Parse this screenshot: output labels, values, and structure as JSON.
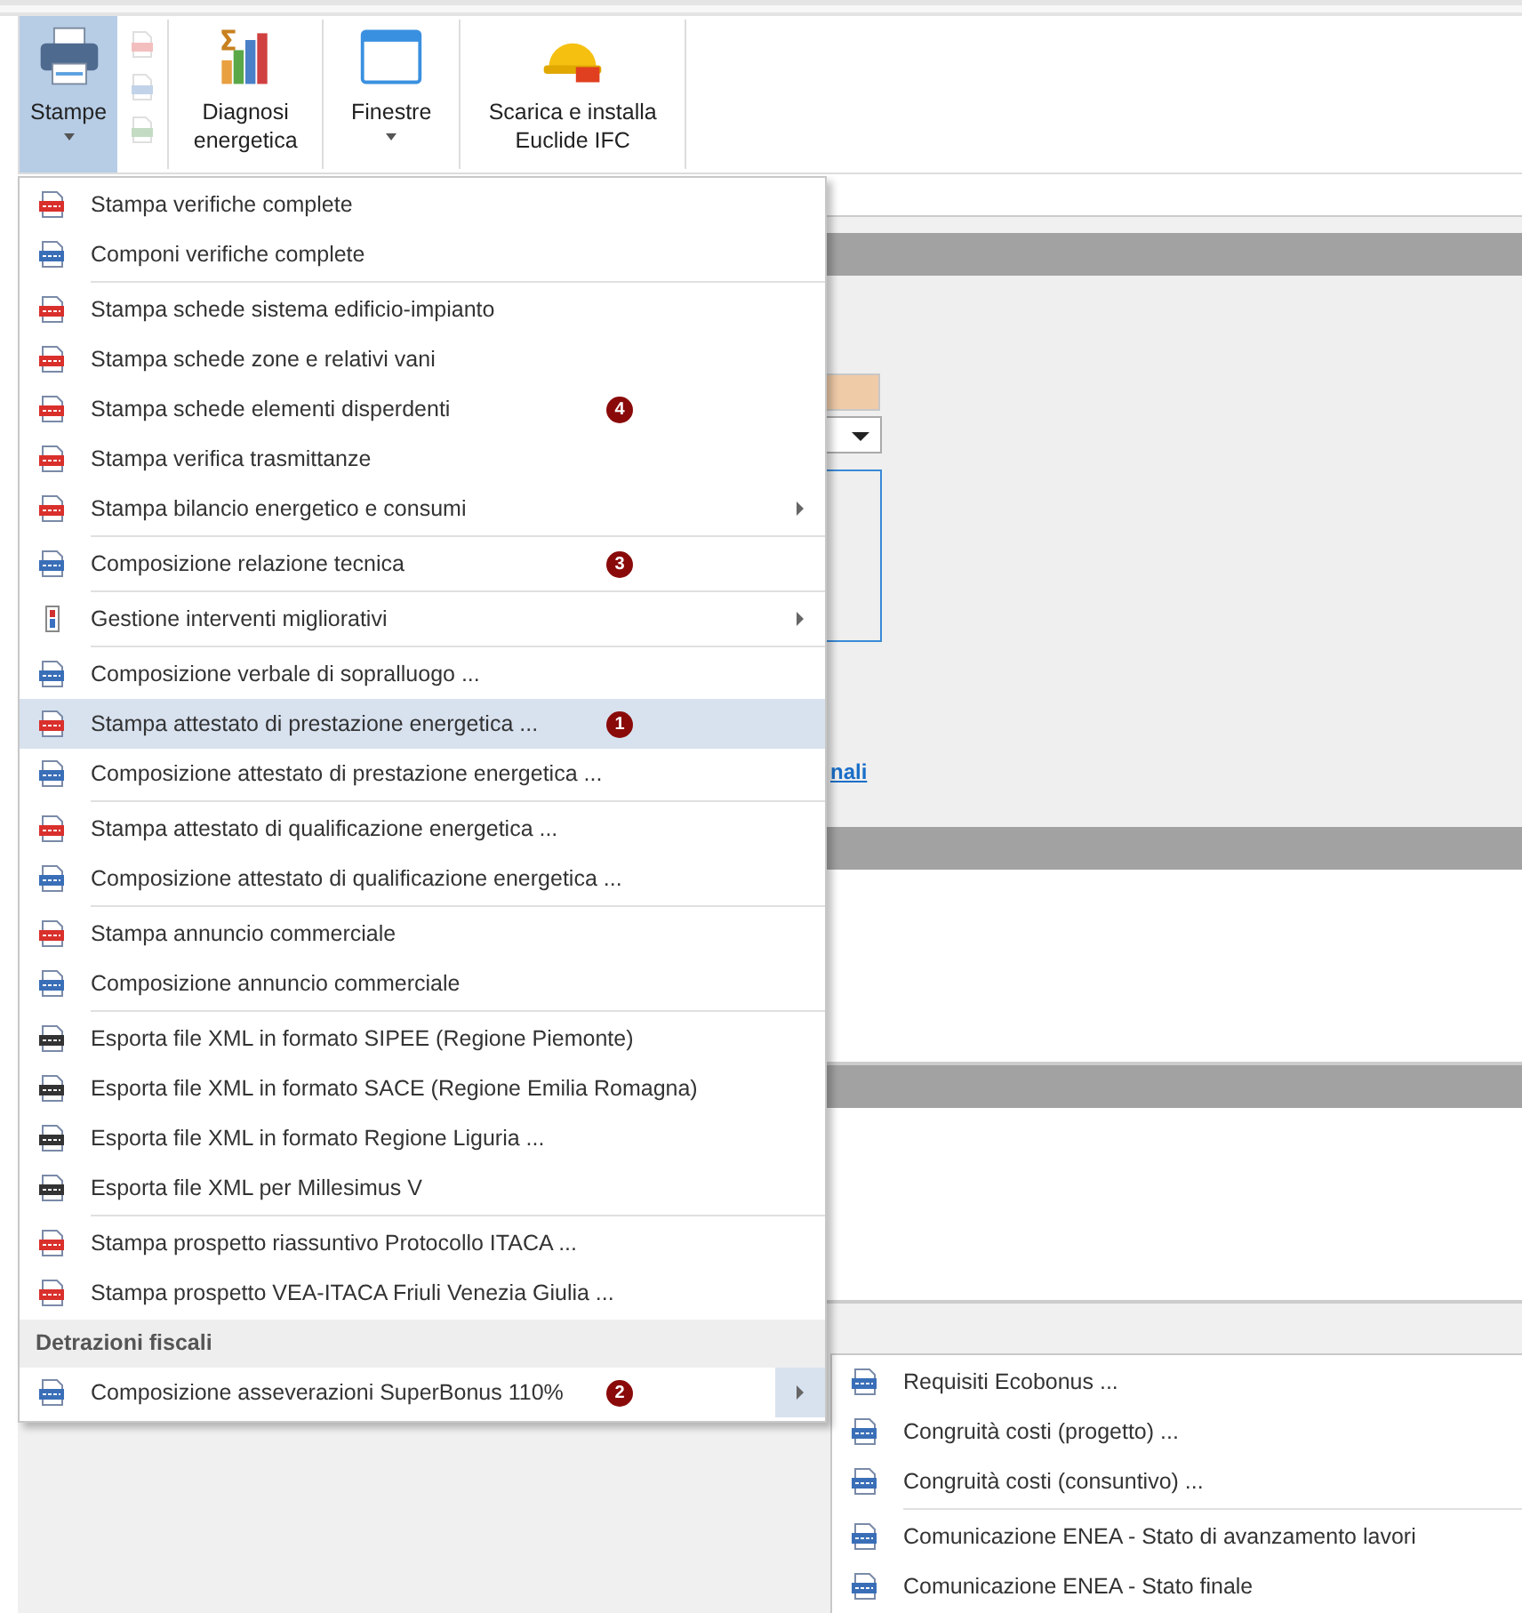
{
  "ribbon": {
    "buttons": [
      {
        "label": "Stampe",
        "kind": "printer",
        "selected": true,
        "dropdown": true
      },
      {
        "label": "Diagnosi energetica",
        "kind": "chart",
        "selected": false,
        "dropdown": false
      },
      {
        "label": "Finestre",
        "kind": "window",
        "selected": false,
        "dropdown": true
      },
      {
        "label": "Scarica e installa Euclide IFC",
        "kind": "helmet",
        "selected": false,
        "dropdown": false
      }
    ],
    "small_buttons": [
      {
        "kind": "pdf",
        "disabled": true
      },
      {
        "kind": "doc",
        "disabled": true
      },
      {
        "kind": "xls",
        "disabled": true
      }
    ]
  },
  "panel": {
    "link": "nali"
  },
  "menu": {
    "items": [
      {
        "kind": "pdf",
        "label": "Stampa verifiche complete",
        "separator_before": false,
        "submenu": false,
        "selected": false
      },
      {
        "kind": "doc",
        "label": "Componi verifiche complete",
        "separator_before": false,
        "submenu": false,
        "selected": false
      },
      {
        "kind": "pdf",
        "label": "Stampa schede sistema edificio-impianto",
        "separator_before": true,
        "submenu": false,
        "selected": false
      },
      {
        "kind": "pdf",
        "label": "Stampa schede zone e relativi vani",
        "separator_before": false,
        "submenu": false,
        "selected": false
      },
      {
        "kind": "pdf",
        "label": "Stampa schede elementi disperdenti",
        "separator_before": false,
        "submenu": false,
        "selected": false,
        "badge": "4"
      },
      {
        "kind": "pdf",
        "label": "Stampa verifica trasmittanze",
        "separator_before": false,
        "submenu": false,
        "selected": false
      },
      {
        "kind": "pdf",
        "label": "Stampa bilancio energetico e consumi",
        "separator_before": false,
        "submenu": true,
        "selected": false
      },
      {
        "kind": "doc",
        "label": "Composizione relazione tecnica",
        "separator_before": true,
        "submenu": false,
        "selected": false,
        "badge": "3"
      },
      {
        "kind": "tool",
        "label": "Gestione interventi migliorativi",
        "separator_before": true,
        "submenu": true,
        "selected": false
      },
      {
        "kind": "doc",
        "label": "Composizione verbale di sopralluogo ...",
        "separator_before": true,
        "submenu": false,
        "selected": false
      },
      {
        "kind": "pdf",
        "label": "Stampa attestato di prestazione energetica ...",
        "separator_before": false,
        "submenu": false,
        "selected": true,
        "badge": "1"
      },
      {
        "kind": "doc",
        "label": "Composizione attestato di prestazione energetica ...",
        "separator_before": false,
        "submenu": false,
        "selected": false
      },
      {
        "kind": "pdf",
        "label": "Stampa attestato di qualificazione energetica ...",
        "separator_before": true,
        "submenu": false,
        "selected": false
      },
      {
        "kind": "doc",
        "label": "Composizione attestato di qualificazione energetica ...",
        "separator_before": false,
        "submenu": false,
        "selected": false
      },
      {
        "kind": "pdf",
        "label": "Stampa annuncio commerciale",
        "separator_before": true,
        "submenu": false,
        "selected": false
      },
      {
        "kind": "doc",
        "label": "Composizione annuncio commerciale",
        "separator_before": false,
        "submenu": false,
        "selected": false
      },
      {
        "kind": "xml",
        "label": "Esporta file XML in formato SIPEE (Regione Piemonte)",
        "separator_before": true,
        "submenu": false,
        "selected": false
      },
      {
        "kind": "xml",
        "label": "Esporta file XML in formato SACE (Regione Emilia Romagna)",
        "separator_before": false,
        "submenu": false,
        "selected": false
      },
      {
        "kind": "xml",
        "label": "Esporta file XML in formato Regione Liguria ...",
        "separator_before": false,
        "submenu": false,
        "selected": false
      },
      {
        "kind": "xml",
        "label": "Esporta file XML per Millesimus V",
        "separator_before": false,
        "submenu": false,
        "selected": false
      },
      {
        "kind": "pdf",
        "label": "Stampa prospetto riassuntivo Protocollo ITACA ...",
        "separator_before": true,
        "submenu": false,
        "selected": false
      },
      {
        "kind": "pdf",
        "label": "Stampa prospetto VEA-ITACA Friuli Venezia Giulia ...",
        "separator_before": false,
        "submenu": false,
        "selected": false
      },
      {
        "kind": "header",
        "label": "Detrazioni fiscali"
      },
      {
        "kind": "doc",
        "label": "Composizione asseverazioni SuperBonus 110%",
        "separator_before": false,
        "submenu": true,
        "expanded": true,
        "selected": false,
        "badge": "2"
      }
    ]
  },
  "submenu": {
    "items": [
      {
        "kind": "doc",
        "label": "Requisiti Ecobonus ...",
        "separator_before": false
      },
      {
        "kind": "doc",
        "label": "Congruità costi (progetto) ...",
        "separator_before": false
      },
      {
        "kind": "doc",
        "label": "Congruità costi (consuntivo) ...",
        "separator_before": false
      },
      {
        "kind": "doc",
        "label": "Comunicazione ENEA - Stato di avanzamento lavori",
        "separator_before": true
      },
      {
        "kind": "doc",
        "label": "Comunicazione ENEA - Stato finale",
        "separator_before": false
      }
    ]
  }
}
